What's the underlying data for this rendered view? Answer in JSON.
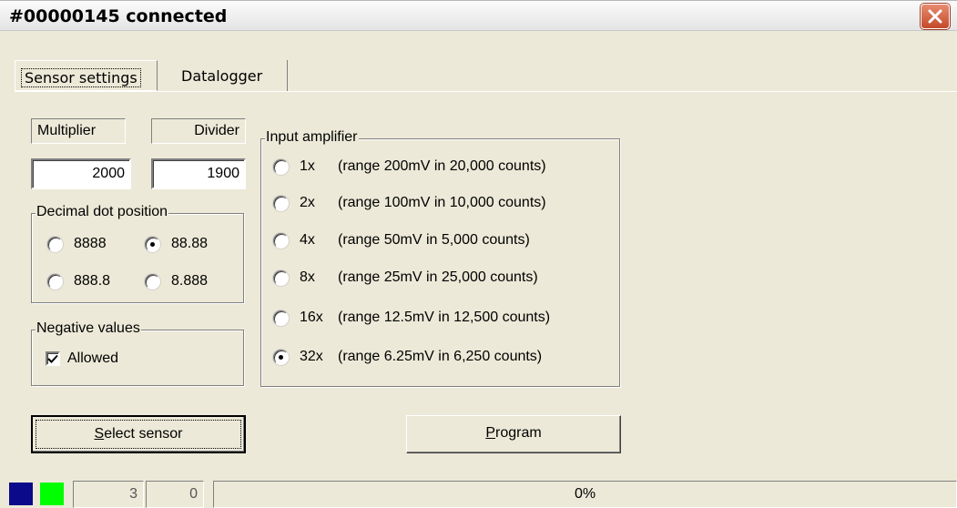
{
  "window": {
    "title": "#00000145 connected"
  },
  "tabs": [
    {
      "label": "Sensor settings",
      "selected": true
    },
    {
      "label": "Datalogger",
      "selected": false
    }
  ],
  "multiplier": {
    "label": "Multiplier",
    "value": "2000"
  },
  "divider": {
    "label": "Divider",
    "value": "1900"
  },
  "decimal_dot": {
    "legend": "Decimal dot position",
    "options": [
      {
        "label": "8888",
        "selected": false
      },
      {
        "label": "88.88",
        "selected": true
      },
      {
        "label": "888.8",
        "selected": false
      },
      {
        "label": "8.888",
        "selected": false
      }
    ]
  },
  "negative_values": {
    "legend": "Negative values",
    "label": "Allowed",
    "checked": true
  },
  "input_amplifier": {
    "legend": "Input amplifier",
    "options": [
      {
        "gain": "1x",
        "range": "(range 200mV in 20,000 counts)",
        "selected": false
      },
      {
        "gain": "2x",
        "range": "(range 100mV in 10,000 counts)",
        "selected": false
      },
      {
        "gain": "4x",
        "range": "(range 50mV in 5,000 counts)",
        "selected": false
      },
      {
        "gain": "8x",
        "range": "(range 25mV in 25,000 counts)",
        "selected": false
      },
      {
        "gain": "16x",
        "range": "(range 12.5mV in 12,500 counts)",
        "selected": false
      },
      {
        "gain": "32x",
        "range": "(range 6.25mV in 6,250 counts)",
        "selected": true
      }
    ]
  },
  "buttons": {
    "select_sensor": {
      "mnemonic": "S",
      "rest": "elect sensor"
    },
    "program": {
      "mnemonic": "P",
      "rest": "rogram"
    }
  },
  "statusbar": {
    "indicator_colors": [
      "#0a0a8a",
      "#00ff00"
    ],
    "count_a": "3",
    "count_b": "0",
    "progress_text": "0%",
    "progress": 0
  }
}
